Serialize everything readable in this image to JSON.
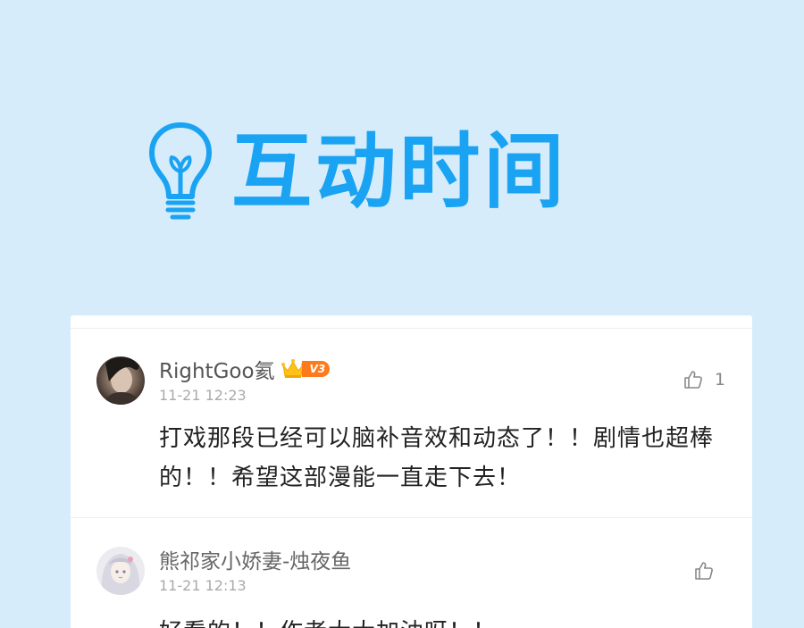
{
  "header": {
    "title": "互动时间",
    "icon": "lightbulb-icon",
    "accent_color": "#1aa3f2",
    "background_color": "#d6ecfa"
  },
  "comments": [
    {
      "username": "RightGoo氦",
      "badge": "V3",
      "time": "11-21 12:23",
      "likes": "1",
      "text": "打戏那段已经可以脑补音效和动态了！！剧情也超棒的！！希望这部漫能一直走下去！"
    },
    {
      "username": "熊祁家小娇妻-烛夜鱼",
      "time": "11-21 12:13",
      "text": "好看的！！作者大大加油呀！！"
    }
  ]
}
